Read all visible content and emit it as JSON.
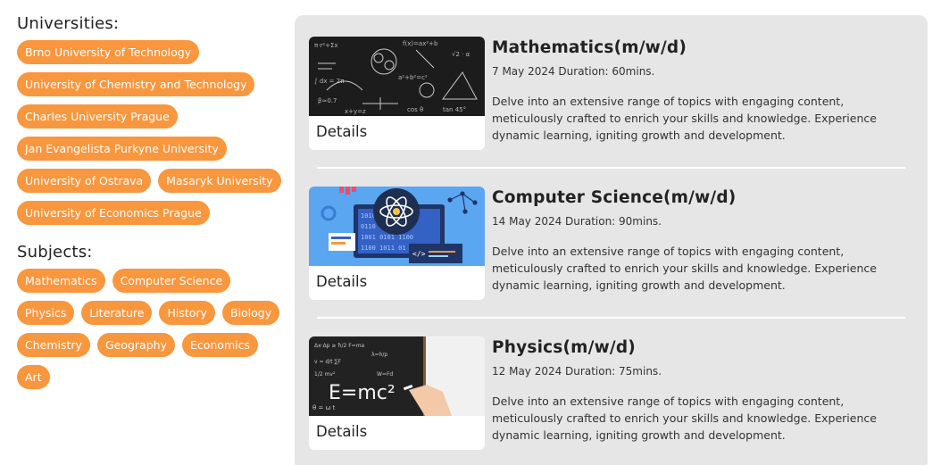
{
  "universities": {
    "title": "Universities:",
    "items": [
      "Brno University of Technology",
      "University of Chemistry and Technology",
      "Charles University Prague",
      "Jan Evangelista Purkyne University",
      "University of Ostrava",
      "Masaryk University",
      "University of Economics Prague"
    ]
  },
  "subjects": {
    "title": "Subjects:",
    "items": [
      "Mathematics",
      "Computer Science",
      "Physics",
      "Literature",
      "History",
      "Biology",
      "Chemistry",
      "Geography",
      "Economics",
      "Art"
    ]
  },
  "courses": [
    {
      "title": "Mathematics(m/w/d)",
      "meta": "7 May 2024 Duration: 60mins.",
      "description": "Delve into an extensive range of topics with engaging content, meticulously crafted to enrich your skills and knowledge. Experience dynamic learning, igniting growth and development.",
      "details_label": "Details",
      "image_icon": "chalkboard-math-image"
    },
    {
      "title": "Computer Science(m/w/d)",
      "meta": "14 May 2024 Duration: 90mins.",
      "description": "Delve into an extensive range of topics with engaging content, meticulously crafted to enrich your skills and knowledge. Experience dynamic learning, igniting growth and development.",
      "details_label": "Details",
      "image_icon": "computer-science-illustration"
    },
    {
      "title": "Physics(m/w/d)",
      "meta": "12 May 2024 Duration: 75mins.",
      "description": "Delve into an extensive range of topics with engaging content, meticulously crafted to enrich your skills and knowledge. Experience dynamic learning, igniting growth and development.",
      "details_label": "Details",
      "image_icon": "chalkboard-physics-image"
    }
  ],
  "colors": {
    "chip": "#f8973e",
    "panel": "#e6e6e6",
    "card": "#ffffff"
  }
}
